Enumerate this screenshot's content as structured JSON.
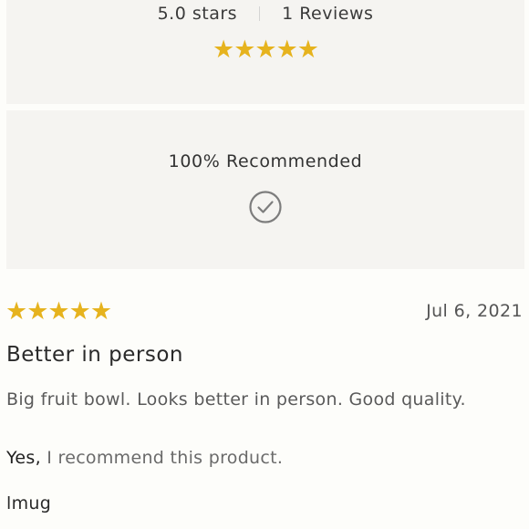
{
  "summary": {
    "rating_text": "5.0 stars",
    "reviews_text": "1 Reviews",
    "stars": "★★★★★",
    "rating_value": 5,
    "rating_max": 5
  },
  "recommendation": {
    "text": "100% Recommended",
    "icon": "check-circle-icon"
  },
  "review": {
    "stars": "★★★★★",
    "rating_value": 5,
    "date": "Jul 6, 2021",
    "title": "Better in person",
    "body": "Big fruit bowl. Looks better in person. Good quality.",
    "recommend_yes": "Yes,",
    "recommend_rest": " I recommend this product.",
    "author": "lmug"
  },
  "colors": {
    "star": "#e6b31e",
    "panel_bg": "#f5f4f1",
    "page_bg": "#fdfdfa"
  }
}
